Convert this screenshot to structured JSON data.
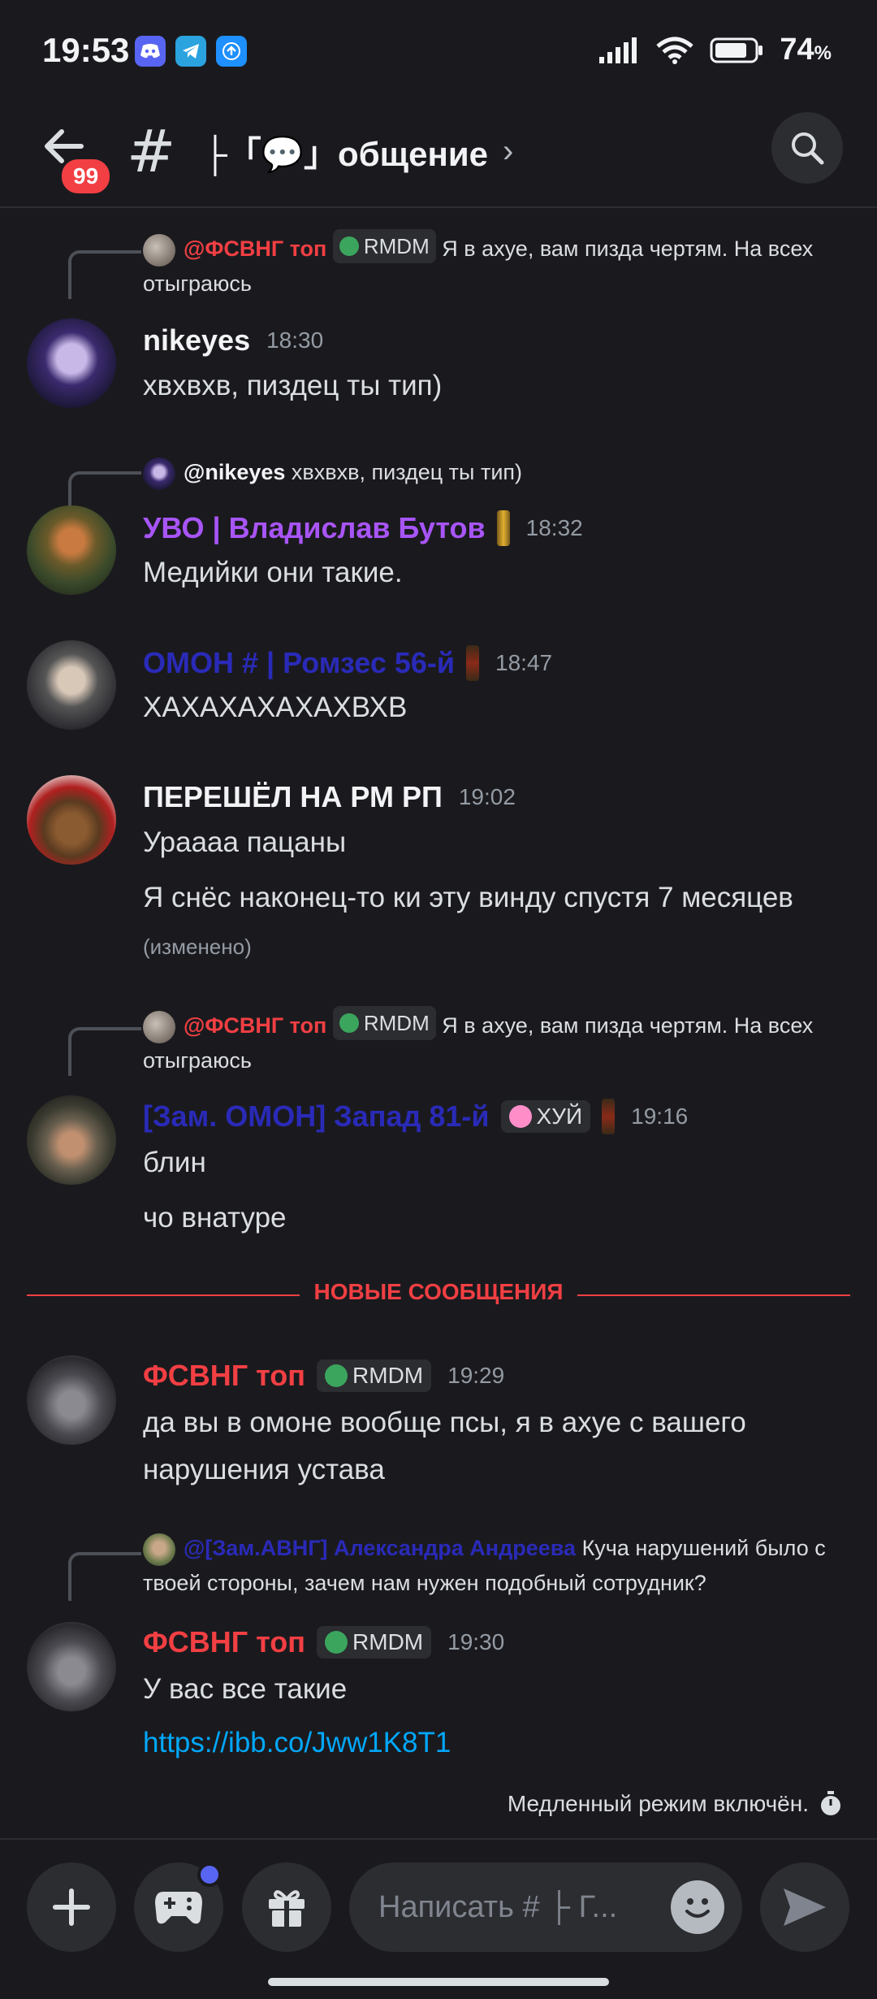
{
  "status_bar": {
    "time": "19:53",
    "battery": "74",
    "battery_unit": "%"
  },
  "header": {
    "back_badge": "99",
    "channel_hash": "#",
    "channel_name": "├「💬」общение",
    "chevron": "›"
  },
  "messages": [
    {
      "reply_author": "@ФСВНГ топ",
      "reply_tag": "RMDM",
      "reply_text": "Я в ахуе, вам пизда чертям. На всех отыграюсь",
      "author": "nikeyes",
      "time": "18:30",
      "lines": [
        "хвхвхв, пиздец ты тип)"
      ]
    },
    {
      "reply_author": "@nikeyes",
      "reply_text": "хвхвхв, пиздец ты тип)",
      "author": "УВО | Владислав Бутов",
      "time": "18:32",
      "lines": [
        "Медийки они такие."
      ]
    },
    {
      "author": "ОМОН # | Ромзес 56-й",
      "time": "18:47",
      "lines": [
        "ХАХАХАХАХАХВХВ"
      ]
    },
    {
      "author": "ПЕРЕШЁЛ НА РМ РП",
      "time": "19:02",
      "lines": [
        "Ураааа пацаны",
        "Я снёс наконец-то ки эту винду спустя 7 месяцев"
      ],
      "edited": "(изменено)"
    },
    {
      "reply_author": "@ФСВНГ топ",
      "reply_tag": "RMDM",
      "reply_text": "Я в ахуе, вам пизда чертям. На всех отыграюсь",
      "author": "[Зам. ОМОН] Запад 81-й",
      "tag": "ХУЙ",
      "time": "19:16",
      "lines": [
        "блин",
        "чо внатуре"
      ]
    },
    {
      "author": "ФСВНГ топ",
      "tag": "RMDM",
      "time": "19:29",
      "lines": [
        "да вы в омоне вообще псы, я в ахуе с вашего нарушения устава"
      ]
    },
    {
      "reply_author": "@[Зам.АВНГ] Александра Андреева",
      "reply_text": "Куча нарушений было с твоей стороны, зачем нам нужен подобный сотрудник?",
      "author": "ФСВНГ топ",
      "tag": "RMDM",
      "time": "19:30",
      "lines": [
        "У вас все такие",
        "https://ibb.co/Jww1K8T1"
      ]
    }
  ],
  "divider": "НОВЫЕ СООБЩЕНИЯ",
  "slowmode": "Медленный режим включён.",
  "composer": {
    "placeholder": "Написать # ├ Г..."
  },
  "colors": {
    "bg": "#1a1a1e",
    "red": "#f23f43",
    "purple": "#a855f7",
    "navy": "#2a2ab8",
    "link": "#00a8fc",
    "tag_green": "#3ba55d"
  }
}
